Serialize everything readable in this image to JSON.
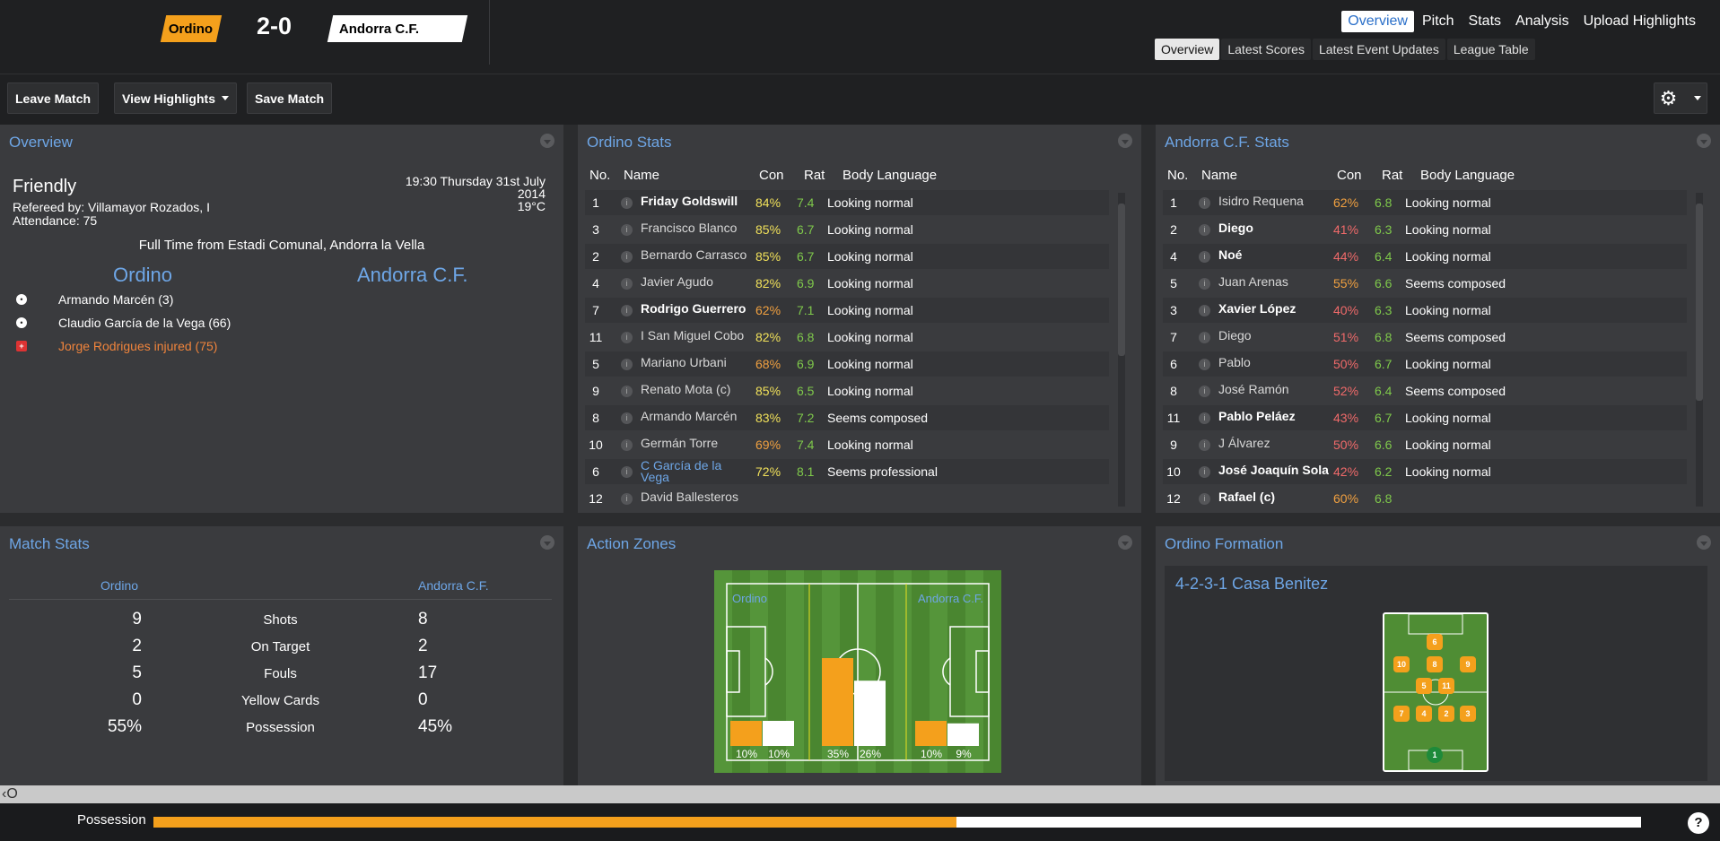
{
  "header": {
    "home_team": "Ordino",
    "away_team": "Andorra C.F.",
    "score": "2-0"
  },
  "nav": {
    "main": [
      "Overview",
      "Pitch",
      "Stats",
      "Analysis",
      "Upload Highlights"
    ],
    "sub": [
      "Overview",
      "Latest Scores",
      "Latest Event Updates",
      "League Table"
    ]
  },
  "toolbar": {
    "leave": "Leave Match",
    "highlights": "View Highlights",
    "save": "Save Match"
  },
  "overview": {
    "title": "Overview",
    "competition": "Friendly",
    "referee": "Refereed by: Villamayor Rozados, I",
    "attendance": "Attendance: 75",
    "time": "19:30 Thursday 31st July",
    "year": "2014",
    "temp": "19°C",
    "venue": "Full Time from Estadi Comunal, Andorra la Vella",
    "home": "Ordino",
    "away": "Andorra C.F.",
    "events": [
      {
        "text": "Armando Marcén (3)",
        "type": "goal"
      },
      {
        "text": "Claudio García de la Vega (66)",
        "type": "goal"
      },
      {
        "text": "Jorge Rodrigues injured (75)",
        "type": "injury"
      }
    ]
  },
  "stats_headers": {
    "no": "No.",
    "name": "Name",
    "con": "Con",
    "rat": "Rat",
    "body": "Body Language"
  },
  "home_stats": {
    "title": "Ordino Stats",
    "rows": [
      {
        "no": "1",
        "name": "Friday Goldswill",
        "con": "84%",
        "rat": "7.4",
        "body": "Looking normal",
        "bold": true
      },
      {
        "no": "3",
        "name": "Francisco Blanco",
        "con": "85%",
        "rat": "6.7",
        "body": "Looking normal"
      },
      {
        "no": "2",
        "name": "Bernardo Carrasco",
        "con": "85%",
        "rat": "6.7",
        "body": "Looking normal"
      },
      {
        "no": "4",
        "name": "Javier Agudo",
        "con": "82%",
        "rat": "6.9",
        "body": "Looking normal"
      },
      {
        "no": "7",
        "name": "Rodrigo Guerrero",
        "con": "62%",
        "rat": "7.1",
        "body": "Looking normal",
        "bold": true
      },
      {
        "no": "11",
        "name": "I San Miguel Cobo",
        "con": "82%",
        "rat": "6.8",
        "body": "Looking normal"
      },
      {
        "no": "5",
        "name": "Mariano Urbani",
        "con": "68%",
        "rat": "6.9",
        "body": "Looking normal"
      },
      {
        "no": "9",
        "name": "Renato Mota (c)",
        "con": "85%",
        "rat": "6.5",
        "body": "Looking normal"
      },
      {
        "no": "8",
        "name": "Armando Marcén",
        "con": "83%",
        "rat": "7.2",
        "body": "Seems composed"
      },
      {
        "no": "10",
        "name": "Germán Torre",
        "con": "69%",
        "rat": "7.4",
        "body": "Looking normal"
      },
      {
        "no": "6",
        "name": "C García de la Vega",
        "con": "72%",
        "rat": "8.1",
        "body": "Seems professional",
        "link": true
      },
      {
        "no": "12",
        "name": "David Ballesteros",
        "con": "",
        "rat": "",
        "body": ""
      }
    ]
  },
  "away_stats": {
    "title": "Andorra C.F. Stats",
    "rows": [
      {
        "no": "1",
        "name": "Isidro Requena",
        "con": "62%",
        "rat": "6.8",
        "body": "Looking normal"
      },
      {
        "no": "2",
        "name": "Diego",
        "con": "41%",
        "rat": "6.3",
        "body": "Looking normal",
        "bold": true
      },
      {
        "no": "4",
        "name": "Noé",
        "con": "44%",
        "rat": "6.4",
        "body": "Looking normal",
        "bold": true
      },
      {
        "no": "5",
        "name": "Juan Arenas",
        "con": "55%",
        "rat": "6.6",
        "body": "Seems composed"
      },
      {
        "no": "3",
        "name": "Xavier López",
        "con": "40%",
        "rat": "6.3",
        "body": "Looking normal",
        "bold": true
      },
      {
        "no": "7",
        "name": "Diego",
        "con": "51%",
        "rat": "6.8",
        "body": "Seems composed"
      },
      {
        "no": "6",
        "name": "Pablo",
        "con": "50%",
        "rat": "6.7",
        "body": "Looking normal"
      },
      {
        "no": "8",
        "name": "José Ramón",
        "con": "52%",
        "rat": "6.4",
        "body": "Seems composed"
      },
      {
        "no": "11",
        "name": "Pablo Peláez",
        "con": "43%",
        "rat": "6.7",
        "body": "Looking normal",
        "bold": true
      },
      {
        "no": "9",
        "name": "J Álvarez",
        "con": "50%",
        "rat": "6.6",
        "body": "Looking normal"
      },
      {
        "no": "10",
        "name": "José Joaquín Sola",
        "con": "42%",
        "rat": "6.2",
        "body": "Looking normal",
        "bold": true
      },
      {
        "no": "12",
        "name": "Rafael (c)",
        "con": "60%",
        "rat": "6.8",
        "body": "",
        "bold": true
      }
    ]
  },
  "match_stats": {
    "title": "Match Stats",
    "home": "Ordino",
    "away": "Andorra C.F.",
    "rows": [
      {
        "label": "Shots",
        "home": "9",
        "away": "8"
      },
      {
        "label": "On Target",
        "home": "2",
        "away": "2"
      },
      {
        "label": "Fouls",
        "home": "5",
        "away": "17"
      },
      {
        "label": "Yellow Cards",
        "home": "0",
        "away": "0"
      },
      {
        "label": "Possession",
        "home": "55%",
        "away": "45%"
      }
    ]
  },
  "action_zones": {
    "title": "Action Zones",
    "home": "Ordino",
    "away": "Andorra C.F.",
    "zones": [
      {
        "home": 10,
        "away": 10,
        "home_label": "10%",
        "away_label": "10%"
      },
      {
        "home": 35,
        "away": 26,
        "home_label": "35%",
        "away_label": "26%"
      },
      {
        "home": 10,
        "away": 9,
        "home_label": "10%",
        "away_label": "9%"
      }
    ]
  },
  "formation": {
    "title": "Ordino Formation",
    "name": "4-2-3-1 Casa Benitez",
    "players": [
      "6",
      "10",
      "8",
      "9",
      "5",
      "11",
      "7",
      "4",
      "2",
      "3",
      "1"
    ]
  },
  "possession": {
    "label": "Possession",
    "home_pct": 54
  },
  "colors": {
    "home": "#f4a01c",
    "away": "#ffffff",
    "accent": "#6ea6e6"
  },
  "icons": {
    "gear": "gear-icon",
    "help": "help-icon",
    "ball": "ball-icon",
    "injury": "injury-icon"
  },
  "help": "?"
}
